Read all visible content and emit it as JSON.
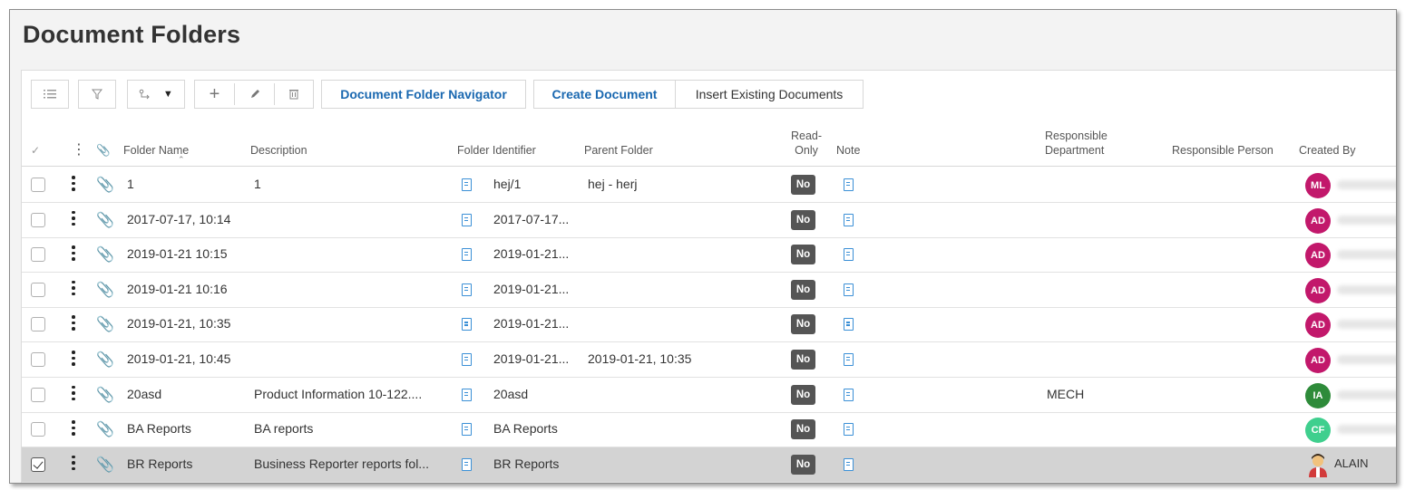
{
  "page": {
    "title": "Document Folders"
  },
  "toolbar": {
    "btn_folder_navigator": "Document Folder Navigator",
    "btn_create_document": "Create Document",
    "btn_insert_existing": "Insert Existing Documents"
  },
  "columns": {
    "folder_name": "Folder Name",
    "description": "Description",
    "folder_identifier": "Folder Identifier",
    "parent_folder": "Parent Folder",
    "read_only_1": "Read-",
    "read_only_2": "Only",
    "note": "Note",
    "resp_dept_1": "Responsible",
    "resp_dept_2": "Department",
    "resp_person": "Responsible Person",
    "created_by": "Created By"
  },
  "rows": [
    {
      "folder_name": "1",
      "description": "1",
      "folder_identifier": "hej/1",
      "parent_folder": "hej - herj",
      "read_only": "No",
      "department": "",
      "created_initials": "ML",
      "created_color": "#c2186b",
      "selected": false
    },
    {
      "folder_name": "2017-07-17, 10:14",
      "description": "",
      "folder_identifier": "2017-07-17...",
      "parent_folder": "",
      "read_only": "No",
      "department": "",
      "created_initials": "AD",
      "created_color": "#c2186b",
      "selected": false
    },
    {
      "folder_name": "2019-01-21 10:15",
      "description": "",
      "folder_identifier": "2019-01-21...",
      "parent_folder": "",
      "read_only": "No",
      "department": "",
      "created_initials": "AD",
      "created_color": "#c2186b",
      "selected": false
    },
    {
      "folder_name": "2019-01-21 10:16",
      "description": "",
      "folder_identifier": "2019-01-21...",
      "parent_folder": "",
      "read_only": "No",
      "department": "",
      "created_initials": "AD",
      "created_color": "#c2186b",
      "selected": false
    },
    {
      "folder_name": "2019-01-21, 10:35",
      "description": "",
      "folder_identifier": "2019-01-21...",
      "parent_folder": "",
      "read_only": "No",
      "department": "",
      "created_initials": "AD",
      "created_color": "#c2186b",
      "selected": false
    },
    {
      "folder_name": "2019-01-21, 10:45",
      "description": "",
      "folder_identifier": "2019-01-21...",
      "parent_folder": "2019-01-21, 10:35",
      "read_only": "No",
      "department": "",
      "created_initials": "AD",
      "created_color": "#c2186b",
      "selected": false
    },
    {
      "folder_name": "20asd",
      "description": "Product Information 10-122....",
      "folder_identifier": "20asd",
      "parent_folder": "",
      "read_only": "No",
      "department": "MECH",
      "created_initials": "IA",
      "created_color": "#2e8b3a",
      "selected": false
    },
    {
      "folder_name": "BA Reports",
      "description": "BA reports",
      "folder_identifier": "BA Reports",
      "parent_folder": "",
      "read_only": "No",
      "department": "",
      "created_initials": "CF",
      "created_color": "#3fcf8e",
      "selected": false
    },
    {
      "folder_name": "BR Reports",
      "description": "Business Reporter reports fol...",
      "folder_identifier": "BR Reports",
      "parent_folder": "",
      "read_only": "No",
      "department": "",
      "created_initials": "",
      "created_name": "ALAIN",
      "created_color": "",
      "selected": true
    }
  ],
  "colors": {
    "link_blue": "#1a68b0",
    "badge_gray": "#555555",
    "selected_row": "#d3d3d3",
    "note_icon_blue": "#3a8fd6"
  },
  "icons": [
    "list-icon",
    "filter-icon",
    "share-icon",
    "caret-down-icon",
    "plus-icon",
    "pencil-icon",
    "trash-icon",
    "checkmark-icon",
    "kebab-icon",
    "paperclip-icon",
    "document-icon",
    "sort-asc-icon"
  ]
}
